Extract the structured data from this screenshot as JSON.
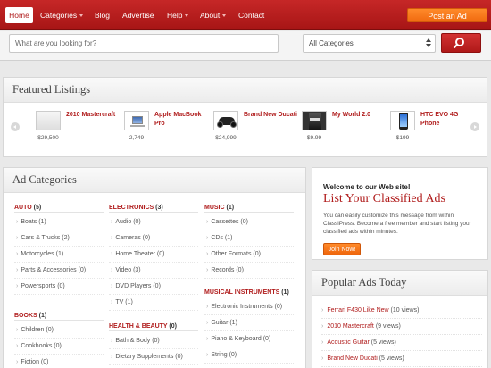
{
  "nav": {
    "items": [
      {
        "label": "Home",
        "caret": false
      },
      {
        "label": "Categories",
        "caret": true
      },
      {
        "label": "Blog",
        "caret": false
      },
      {
        "label": "Advertise",
        "caret": false
      },
      {
        "label": "Help",
        "caret": true
      },
      {
        "label": "About",
        "caret": true
      },
      {
        "label": "Contact",
        "caret": false
      }
    ],
    "post_ad": "Post an Ad"
  },
  "search": {
    "placeholder": "What are you looking for?",
    "category_selected": "All Categories"
  },
  "featured": {
    "title": "Featured Listings",
    "items": [
      {
        "name": "2010 Mastercraft",
        "price": "$29,500",
        "icon": "boat-thumbnail"
      },
      {
        "name": "Apple MacBook Pro",
        "price": "2,749",
        "icon": "laptop-thumbnail"
      },
      {
        "name": "Brand New Ducati",
        "price": "$24,999",
        "icon": "motorcycle-thumbnail"
      },
      {
        "name": "My World 2.0",
        "price": "$9.99",
        "icon": "album-thumbnail"
      },
      {
        "name": "HTC EVO 4G Phone",
        "price": "$199",
        "icon": "phone-thumbnail"
      }
    ]
  },
  "categories": {
    "title": "Ad Categories",
    "columns": [
      [
        {
          "name": "AUTO",
          "count": "(5)",
          "subs": [
            "Boats (1)",
            "Cars & Trucks (2)",
            "Motorcycles (1)",
            "Parts & Accessories (0)",
            "Powersports (0)"
          ]
        },
        {
          "name": "BOOKS",
          "count": "(1)",
          "subs": [
            "Children (0)",
            "Cookbooks (0)",
            "Fiction (0)"
          ]
        }
      ],
      [
        {
          "name": "ELECTRONICS",
          "count": "(3)",
          "subs": [
            "Audio (0)",
            "Cameras (0)",
            "Home Theater (0)",
            "Video (3)",
            "DVD Players (0)",
            "TV (1)"
          ]
        },
        {
          "name": "HEALTH & BEAUTY",
          "count": "(0)",
          "subs": [
            "Bath & Body (0)",
            "Dietary Supplements (0)"
          ]
        }
      ],
      [
        {
          "name": "MUSIC",
          "count": "(1)",
          "subs": [
            "Cassettes (0)",
            "CDs (1)",
            "Other Formats (0)",
            "Records (0)"
          ]
        },
        {
          "name": "MUSICAL INSTRUMENTS",
          "count": "(1)",
          "subs": [
            "Electronic Instruments (0)",
            "Guitar (1)",
            "Piano & Keyboard (0)",
            "String (0)"
          ]
        }
      ]
    ]
  },
  "welcome": {
    "small": "Welcome to our Web site!",
    "big": "List Your Classified Ads",
    "text": "You can easily customize this message from within ClassiPress. Become a free member and start listing your classified ads within minutes.",
    "button": "Join Now!"
  },
  "popular": {
    "title": "Popular Ads Today",
    "items": [
      {
        "name": "Ferrari F430 Like New",
        "views": "(10 views)"
      },
      {
        "name": "2010 Mastercraft",
        "views": "(9 views)"
      },
      {
        "name": "Acoustic Guitar",
        "views": "(5 views)"
      },
      {
        "name": "Brand New Ducati",
        "views": "(5 views)"
      }
    ]
  },
  "colors": {
    "accent": "#b01c1c",
    "button_orange": "#f06a10",
    "nav_red": "#c62727"
  }
}
